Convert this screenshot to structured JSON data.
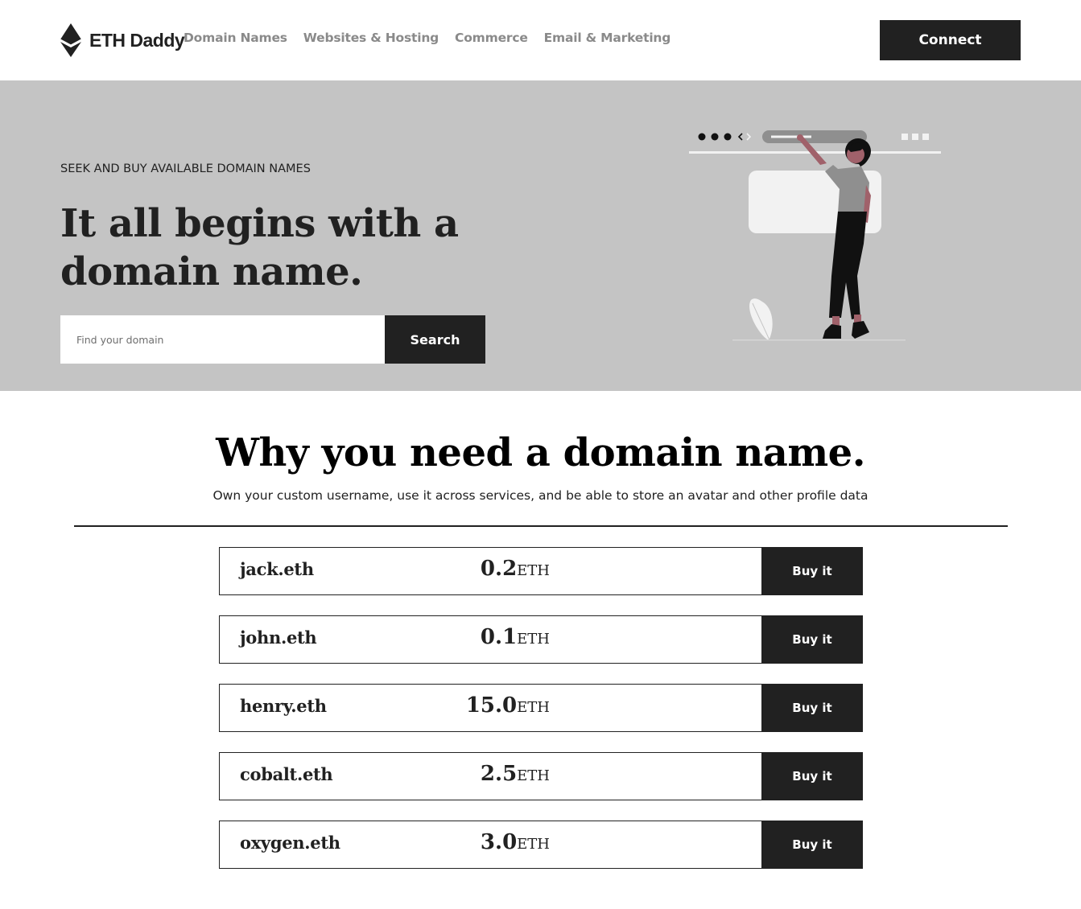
{
  "nav": {
    "brand_name": "ETH Daddy",
    "links": [
      {
        "label": "Domain Names"
      },
      {
        "label": "Websites & Hosting"
      },
      {
        "label": "Commerce"
      },
      {
        "label": "Email & Marketing"
      }
    ],
    "connect_label": "Connect"
  },
  "hero": {
    "eyebrow": "SEEK AND BUY AVAILABLE DOMAIN NAMES",
    "headline": "It all begins with a domain name.",
    "search_placeholder": "Find your domain",
    "search_button": "Search"
  },
  "info": {
    "title": "Why you need a domain name.",
    "subtitle": "Own your custom username, use it across services, and be able to store an avatar and other profile data"
  },
  "domains": [
    {
      "name": "jack.eth",
      "price": "0.2",
      "unit": "ETH",
      "button": "Buy it"
    },
    {
      "name": "john.eth",
      "price": "0.1",
      "unit": "ETH",
      "button": "Buy it"
    },
    {
      "name": "henry.eth",
      "price": "15.0",
      "unit": "ETH",
      "button": "Buy it"
    },
    {
      "name": "cobalt.eth",
      "price": "2.5",
      "unit": "ETH",
      "button": "Buy it"
    },
    {
      "name": "oxygen.eth",
      "price": "3.0",
      "unit": "ETH",
      "button": "Buy it"
    }
  ],
  "colors": {
    "primary_dark": "#212121",
    "hero_background": "#c4c4c4",
    "nav_link": "#8a8a8a",
    "accent_skin": "#a0616a"
  },
  "icons": {
    "brand_logo": "ethereum-diamond-icon"
  }
}
